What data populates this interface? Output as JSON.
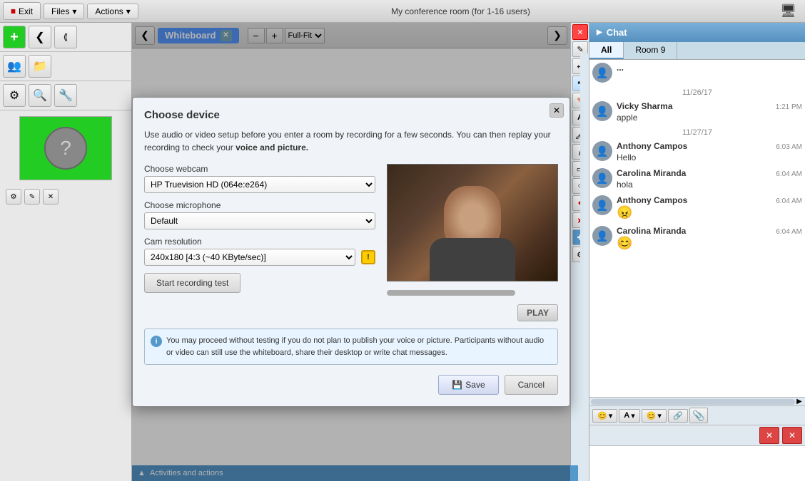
{
  "topbar": {
    "exit_label": "Exit",
    "files_label": "Files",
    "actions_label": "Actions",
    "conference_title": "My conference room (for 1-16 users)"
  },
  "whiteboard": {
    "tab_label": "Whiteboard",
    "zoom_minus": "−",
    "zoom_plus": "+",
    "zoom_option": "Full-Fit",
    "nav_left": "❮",
    "nav_right": "❯"
  },
  "modal": {
    "title": "Choose device",
    "description_part1": "Use audio or video setup before you enter a room by recording for a few seconds. You can then replay your recording to check your ",
    "description_bold": "voice and picture.",
    "webcam_label": "Choose webcam",
    "webcam_value": "HP Truevision HD (064e:e264)",
    "microphone_label": "Choose microphone",
    "microphone_value": "Default",
    "cam_resolution_label": "Cam resolution",
    "cam_resolution_value": "240x180 [4:3 (~40 KByte/sec)]",
    "record_btn_label": "Start recording test",
    "play_btn_label": "PLAY",
    "info_text": "You may proceed without testing if you do not plan to publish your voice or picture. Participants without audio or video can still use the whiteboard, share their desktop or write chat messages.",
    "save_label": "Save",
    "cancel_label": "Cancel"
  },
  "chat": {
    "header_label": "Chat",
    "tab_all": "All",
    "tab_room9": "Room 9",
    "messages": [
      {
        "date": "11/26/17",
        "entries": [
          {
            "name": "Vicky Sharma",
            "time": "1:21 PM",
            "text": "apple"
          }
        ]
      },
      {
        "date": "11/27/17",
        "entries": [
          {
            "name": "Anthony Campos",
            "time": "6:03 AM",
            "text": "Hello"
          },
          {
            "name": "Carolina Miranda",
            "time": "6:04 AM",
            "text": "hola"
          },
          {
            "name": "Anthony Campos",
            "time": "6:04 AM",
            "text": ""
          },
          {
            "name": "Carolina Miranda",
            "time": "6:04 AM",
            "text": ""
          }
        ]
      }
    ]
  },
  "bottom_bar": {
    "label": "Activities and actions"
  },
  "icons": {
    "users": "👥",
    "folder": "📁",
    "gear": "⚙",
    "webcam_search": "🔍",
    "tools": "🔧",
    "arrow_left": "❮",
    "arrow_right": "❯",
    "close": "✕",
    "question": "?",
    "cursor": "↖",
    "draw": "✎",
    "text_tool": "A",
    "paint": "🖌",
    "line": "/",
    "rect": "▭",
    "ellipse": "○",
    "red_dot": "●",
    "arrow_red": "➤",
    "plus_cross": "✚",
    "settings": "⚙",
    "emoji": "😊",
    "font": "A",
    "emoji2": "😊",
    "link": "🔗",
    "attachment": "📎",
    "cancel_x": "✕",
    "send": "↩"
  }
}
